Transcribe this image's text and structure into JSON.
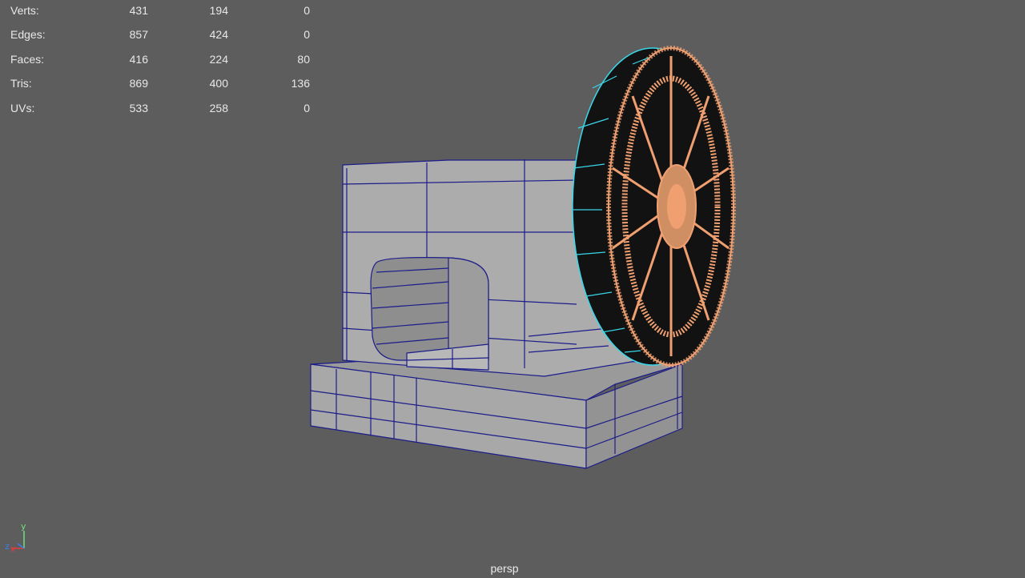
{
  "hud": {
    "rows": [
      {
        "label": "Verts:",
        "values": [
          "431",
          "194",
          "0"
        ]
      },
      {
        "label": "Edges:",
        "values": [
          "857",
          "424",
          "0"
        ]
      },
      {
        "label": "Faces:",
        "values": [
          "416",
          "224",
          "80"
        ]
      },
      {
        "label": "Tris:",
        "values": [
          "869",
          "400",
          "136"
        ]
      },
      {
        "label": "UVs:",
        "values": [
          "533",
          "258",
          "0"
        ]
      }
    ]
  },
  "axis": {
    "y": "y",
    "z": "z",
    "x": "x"
  },
  "camera": {
    "name": "persp"
  },
  "colors": {
    "background": "#5d5d5d",
    "mesh_fill": "#a6a6a6",
    "wire": "#1c1c8a",
    "selected_wire": "#f0a070",
    "selected_edge": "#39d7ea",
    "axis_y": "#6fe07f",
    "axis_x": "#e23c3c",
    "axis_z": "#3f7fe8"
  }
}
